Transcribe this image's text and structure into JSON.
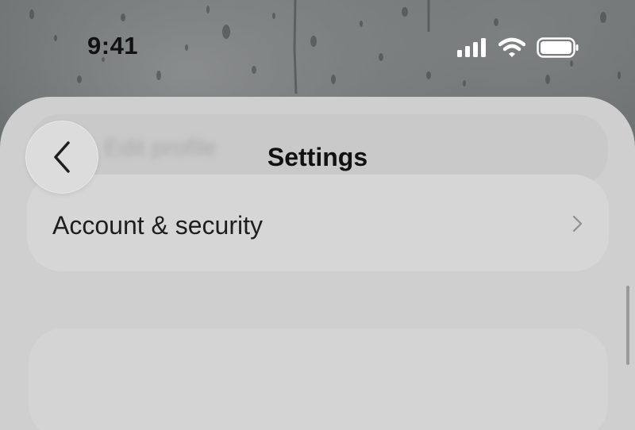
{
  "status_bar": {
    "time": "9:41",
    "icons": [
      "cellular-signal-icon",
      "wifi-icon",
      "battery-icon"
    ]
  },
  "nav": {
    "title": "Settings",
    "back_icon": "chevron-left-icon"
  },
  "ghost_item": {
    "label": "Edit profile"
  },
  "list": {
    "items": [
      {
        "label": "Account & security",
        "icon": "chevron-right-icon"
      }
    ]
  },
  "colors": {
    "sheet": "#cfcfcf",
    "card": "#d6d6d6",
    "text": "#1e1e1e",
    "chevron": "#8e8e93"
  }
}
